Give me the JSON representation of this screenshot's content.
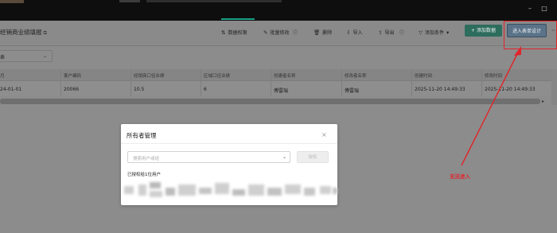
{
  "window": {
    "minimize_label": "–",
    "maximize_label": "□"
  },
  "toolbar": {
    "title": "经销商业绩填报",
    "title_hint": "⧉",
    "actions": [
      {
        "icon": "⇅",
        "label": "数据权限"
      },
      {
        "icon": "✎",
        "label": "批量修改"
      },
      {
        "icon": "ⓘ",
        "label": ""
      },
      {
        "icon": "🗑",
        "label": "删除"
      },
      {
        "icon": "⇩",
        "label": "导入"
      },
      {
        "icon": "⇧",
        "label": "导出"
      },
      {
        "icon": "ⓘ",
        "label": ""
      },
      {
        "icon": "▽",
        "label": "添加条件"
      },
      {
        "icon": "▾",
        "label": ""
      }
    ],
    "add_label": "+ 添加数据",
    "design_label": "进入表单设计",
    "more_label": "···"
  },
  "filter": {
    "selected": "表",
    "chevron": "⌄"
  },
  "table": {
    "columns": [
      "月",
      "客户编码",
      "经销商口径业绩",
      "区域口径业绩",
      "创建者名称",
      "修改者名称",
      "创建时间",
      "修改时间"
    ],
    "rows": [
      [
        "24-01-01",
        "20066",
        "10.5",
        "6",
        "傅雷瑞",
        "傅雷瑞",
        "2025-11-20 14:49:33",
        "2025-11-20 14:49:33"
      ]
    ],
    "scroll_right": "▸"
  },
  "modal": {
    "title": "所有者管理",
    "close": "×",
    "search_placeholder": "搜索用户或组",
    "grant_label": "授权",
    "granted_text": "已授权给1位用户"
  },
  "annotation": {
    "label": "无法进入",
    "color": "#e0252b"
  },
  "colors": {
    "accent": "#2d6d5e",
    "design_button": "#5b7388",
    "annotation_red": "#e0252b"
  }
}
